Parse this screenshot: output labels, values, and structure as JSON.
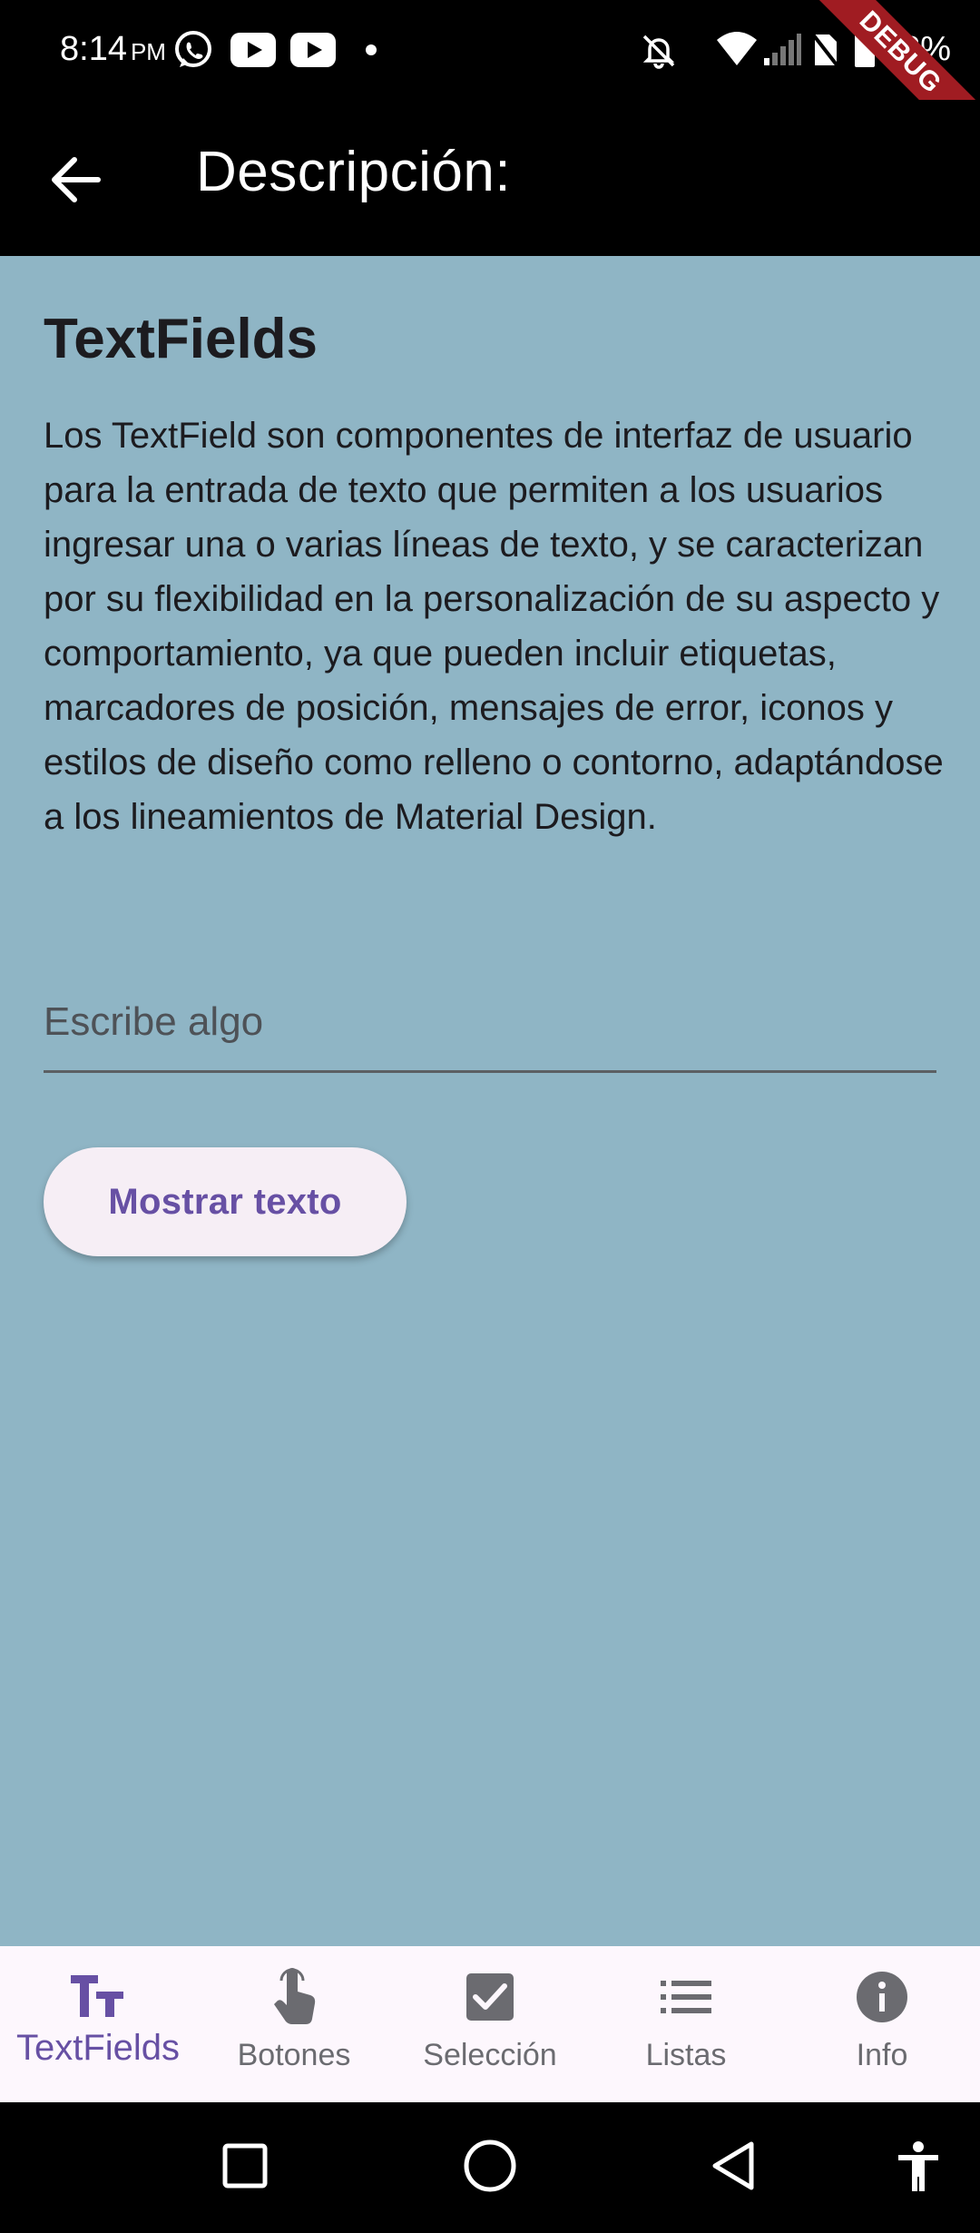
{
  "status_bar": {
    "time": "8:14",
    "ampm": "PM",
    "battery": "68%"
  },
  "debug_banner": "DEBUG",
  "app_bar": {
    "title": "Descripción:"
  },
  "content": {
    "title": "TextFields",
    "description": "Los TextField son componentes de interfaz de usuario para la entrada de texto que permiten a los usuarios ingresar una o varias líneas de texto, y se caracterizan por su flexibilidad en la personalización de su aspecto y comportamiento, ya que pueden incluir etiquetas, marcadores de posición, mensajes de error, iconos y estilos de diseño como relleno o contorno, adaptándose a los lineamientos de Material Design.",
    "input_placeholder": "Escribe algo",
    "input_value": "",
    "button_label": "Mostrar texto"
  },
  "bottom_nav": {
    "items": [
      {
        "label": "TextFields",
        "icon": "text-fields-icon",
        "selected": true
      },
      {
        "label": "Botones",
        "icon": "touch-icon",
        "selected": false
      },
      {
        "label": "Selección",
        "icon": "checkbox-icon",
        "selected": false
      },
      {
        "label": "Listas",
        "icon": "list-icon",
        "selected": false
      },
      {
        "label": "Info",
        "icon": "info-icon",
        "selected": false
      }
    ]
  },
  "colors": {
    "accent": "#6750a4",
    "content_background": "#8fb5c5",
    "nav_background": "#fdf7fd"
  }
}
